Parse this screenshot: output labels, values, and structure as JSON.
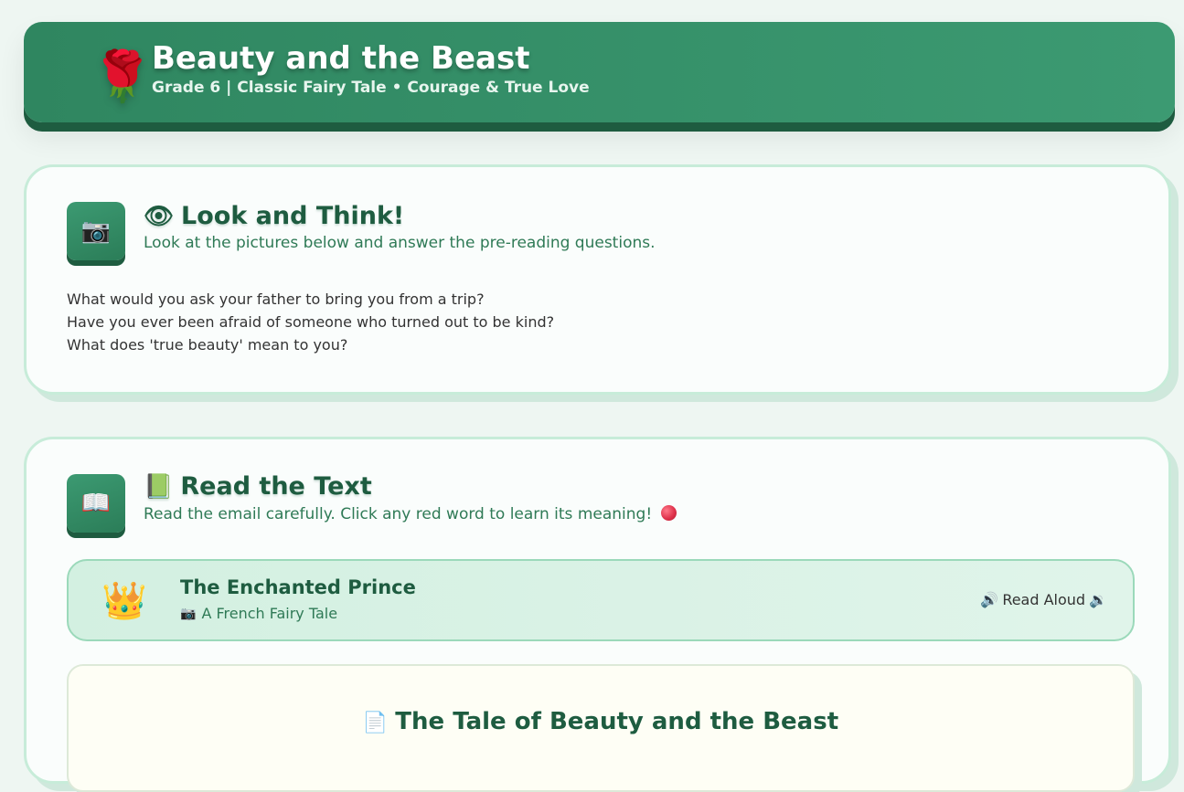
{
  "header": {
    "icon": "rose-icon",
    "title": "Beauty and the Beast",
    "subtitle": "Grade 6  |  Classic Fairy Tale • Courage & True Love"
  },
  "look_section": {
    "badge_icon": "camera-icon",
    "title_icon": "eye-icon",
    "title": "Look and Think!",
    "subtitle": "Look at the pictures below and answer the pre-reading questions.",
    "questions": [
      "What would you ask your father to bring you from a trip?",
      "Have you ever been afraid of someone who turned out to be kind?",
      "What does 'true beauty' mean to you?"
    ]
  },
  "read_section": {
    "badge_icon": "open-book-icon",
    "title_icon": "book-icon",
    "title": "Read the Text",
    "subtitle": "Read the email carefully. Click any red word to learn its meaning!",
    "story": {
      "icon": "crown-icon",
      "title": "The Enchanted Prince",
      "sub_icon": "camera-icon",
      "sub": "A French Fairy Tale",
      "read_aloud_label": "Read Aloud"
    },
    "paper": {
      "icon": "document-icon",
      "title": "The Tale of Beauty and the Beast"
    }
  },
  "colors": {
    "brand_green": "#2f8660",
    "dark_green": "#1e5c40",
    "card_border": "#c7ecd9",
    "red_dot": "#e0344d"
  }
}
